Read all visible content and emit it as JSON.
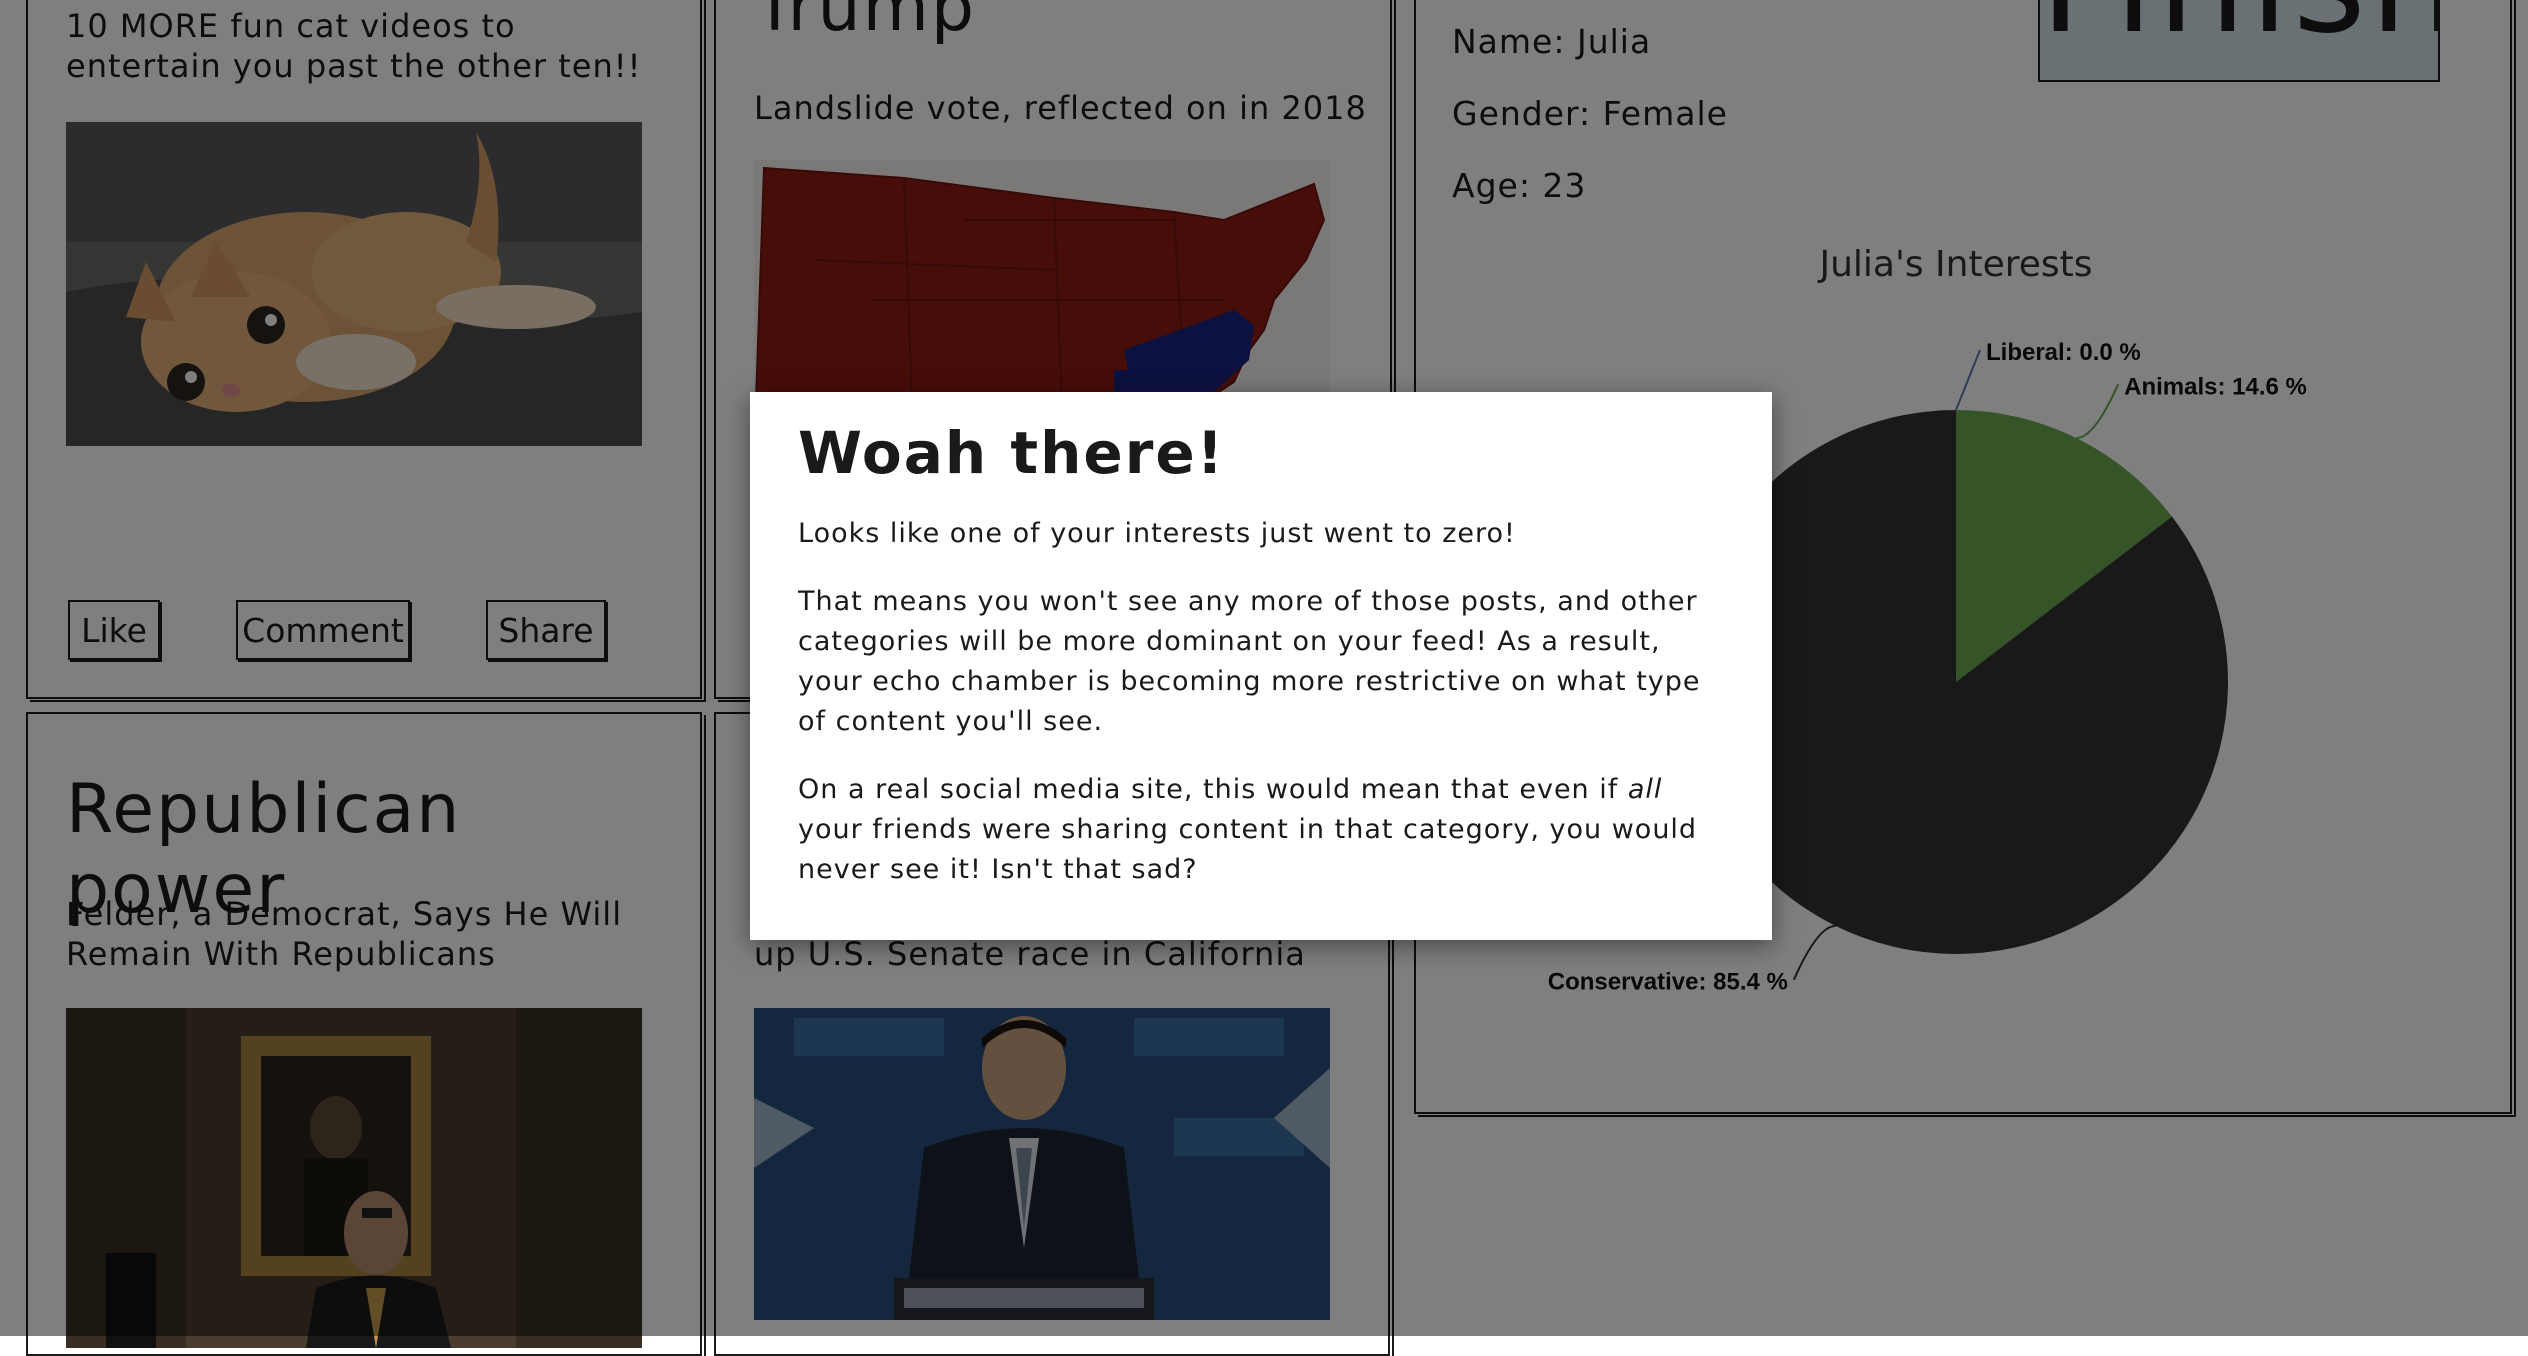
{
  "feed": {
    "cat_post": {
      "text": "10 MORE fun cat videos to entertain you past the other ten!!",
      "like": "Like",
      "comment": "Comment",
      "share": "Share"
    },
    "trump_post": {
      "title": "Trump",
      "text": "Landslide vote, reflected on in 2018"
    },
    "republican_post": {
      "title": "Republican power",
      "text": "Felder, a Democrat, Says He Will Remain With Republicans"
    },
    "senate_post": {
      "text": "up U.S. Senate race in California"
    }
  },
  "profile": {
    "finish_label": "Finish",
    "name": "Name: Julia",
    "gender": "Gender: Female",
    "age": "Age: 23"
  },
  "chart_data": {
    "type": "pie",
    "title": "Julia's Interests",
    "slices": [
      {
        "name": "Liberal",
        "value": 0.0,
        "label": "Liberal: 0.0 %",
        "color": "#5a7fa8"
      },
      {
        "name": "Animals",
        "value": 14.6,
        "label": "Animals: 14.6 %",
        "color": "#6aa84f"
      },
      {
        "name": "Conservative",
        "value": 85.4,
        "label": "Conservative: 85.4 %",
        "color": "#333333"
      }
    ]
  },
  "modal": {
    "title": "Woah there!",
    "p1": "Looks like one of your interests just went to zero!",
    "p2": "That means you won't see any more of those posts, and other categories will be more dominant on your feed! As a result, your echo chamber is becoming more restrictive on what type of content you'll see.",
    "p3_before": "On a real social media site, this would mean that even if ",
    "p3_em": "all",
    "p3_after": " your friends were sharing content in that category, you would never see it! Isn't that sad?"
  }
}
